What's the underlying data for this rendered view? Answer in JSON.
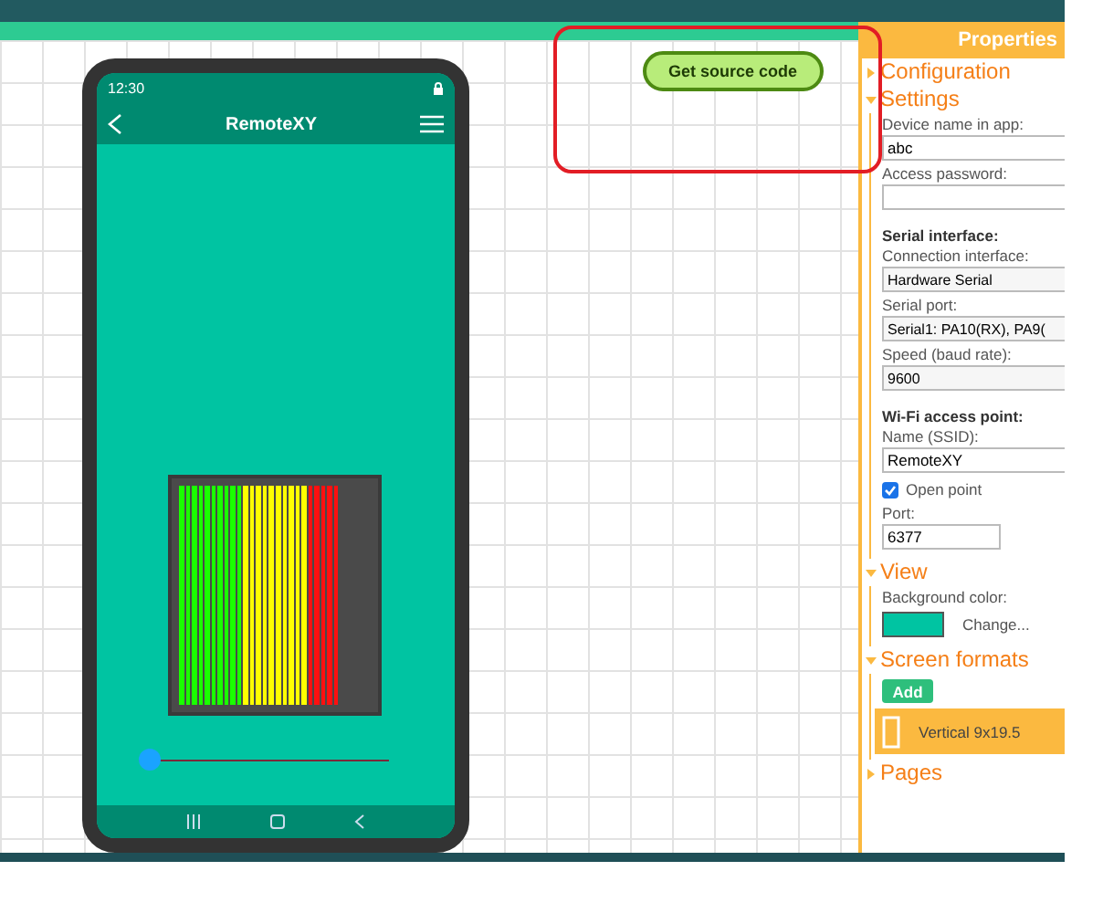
{
  "properties_title": "Properties",
  "source_button": "Get source code",
  "phone": {
    "time": "12:30",
    "title": "RemoteXY",
    "level_indicator": {
      "level": 0.82
    },
    "slider": {
      "level": 0
    }
  },
  "sections": [
    {
      "title": "Configuration",
      "expanded": false
    },
    {
      "title": "Settings",
      "expanded": true,
      "items": [
        {
          "kind": "label",
          "text": "Device name in app:"
        },
        {
          "kind": "input",
          "value": "abc"
        },
        {
          "kind": "label",
          "text": "Access password:"
        },
        {
          "kind": "input"
        },
        {
          "kind": "heading",
          "text": "Serial interface:"
        },
        {
          "kind": "label",
          "text": "Connection interface:"
        },
        {
          "kind": "select",
          "value": "Hardware Serial"
        },
        {
          "kind": "label",
          "text": "Serial port:"
        },
        {
          "kind": "select",
          "value": "Serial1: PA10(RX), PA9("
        },
        {
          "kind": "label",
          "text": "Speed (baud rate):"
        },
        {
          "kind": "select",
          "value": "9600"
        },
        {
          "kind": "heading",
          "text": "Wi-Fi access point:"
        },
        {
          "kind": "label",
          "text": "Name (SSID):"
        },
        {
          "kind": "input",
          "value": "RemoteXY"
        },
        {
          "kind": "checkbox",
          "text": "Open point",
          "checked": true
        },
        {
          "kind": "label",
          "text": "Port:"
        },
        {
          "kind": "short_input",
          "value": "6377"
        }
      ]
    },
    {
      "title": "View",
      "expanded": true,
      "items": [
        {
          "kind": "label",
          "text": "Background color:"
        },
        {
          "kind": "color",
          "color": "#00c4a2",
          "text": "Change..."
        }
      ]
    },
    {
      "title": "Screen formats",
      "expanded": true,
      "items": [
        {
          "kind": "add_button",
          "text": "Add"
        },
        {
          "kind": "format",
          "text": "Vertical 9x19.5",
          "selected": true
        }
      ]
    },
    {
      "title": "Pages",
      "expanded": false
    }
  ]
}
